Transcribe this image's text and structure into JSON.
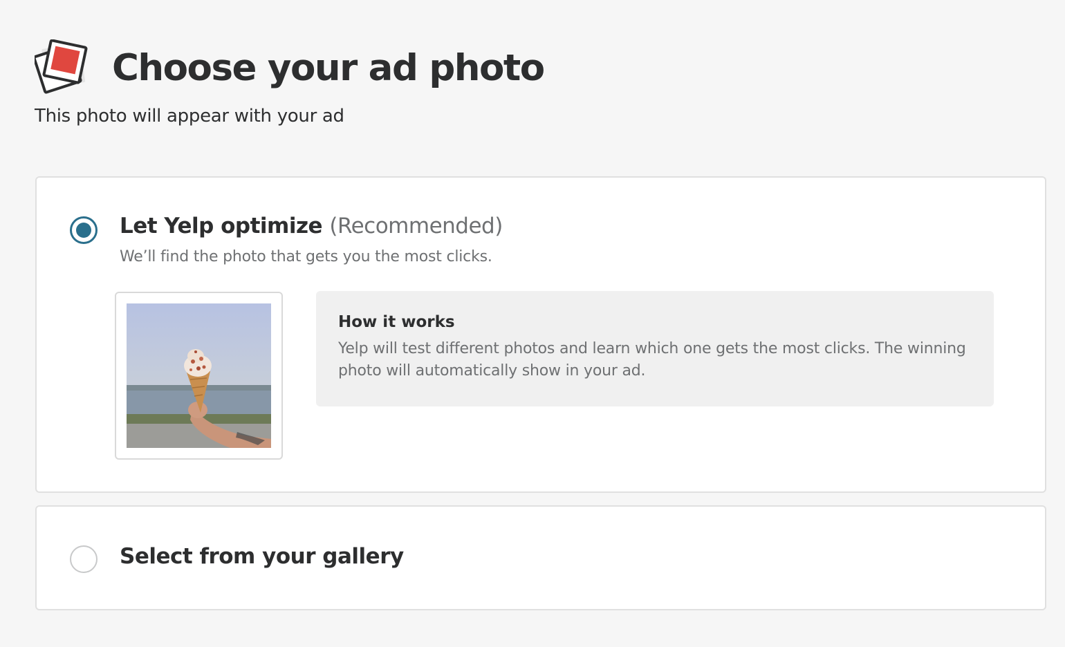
{
  "header": {
    "icon": "photos-icon",
    "title": "Choose your ad photo",
    "subtitle": "This photo will appear with your ad"
  },
  "options": {
    "optimize": {
      "selected": true,
      "title": "Let Yelp optimize",
      "title_note": "(Recommended)",
      "description": "We’ll find the photo that gets you the most clicks.",
      "preview_photo": "ice-cream-cone-photo",
      "how_it_works": {
        "title": "How it works",
        "text": "Yelp will test different photos and learn which one gets the most clicks. The winning photo will automatically show in your ad."
      }
    },
    "gallery": {
      "selected": false,
      "title": "Select from your gallery"
    }
  },
  "colors": {
    "accent": "#2a6f8c",
    "background": "#f6f6f6",
    "card_border": "#e0e0e0",
    "muted_text": "#6e7072",
    "icon_red": "#e0473f"
  }
}
